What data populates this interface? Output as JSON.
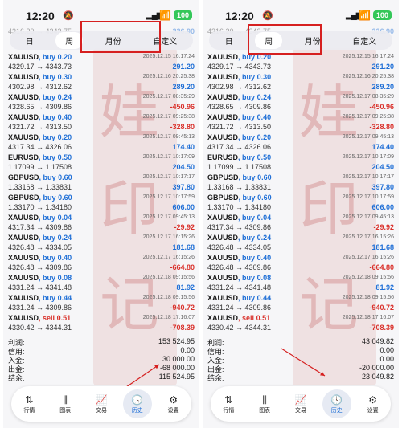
{
  "status": {
    "time": "12:20",
    "battery": "100"
  },
  "segments": [
    "日",
    "周",
    "月份",
    "自定义"
  ],
  "panels": [
    {
      "active_segment": "周",
      "partial_top": {
        "label": "4316.20 → 4343.75",
        "profit": "336.90"
      },
      "trades": [
        {
          "symbol": "XAUUSD",
          "side": "buy",
          "lot": "0.20",
          "prices": "4329.17 → 4343.73",
          "time": "2025.12.15 16:17:24",
          "profit": "291.20",
          "sign": "pos"
        },
        {
          "symbol": "XAUUSD",
          "side": "buy",
          "lot": "0.30",
          "prices": "4302.98 → 4312.62",
          "time": "2025.12.16 20:25:38",
          "profit": "289.20",
          "sign": "pos"
        },
        {
          "symbol": "XAUUSD",
          "side": "buy",
          "lot": "0.24",
          "prices": "4328.65 → 4309.86",
          "time": "2025.12.17 08:35:29",
          "profit": "-450.96",
          "sign": "neg"
        },
        {
          "symbol": "XAUUSD",
          "side": "buy",
          "lot": "0.40",
          "prices": "4321.72 → 4313.50",
          "time": "2025.12.17 09:25:38",
          "profit": "-328.80",
          "sign": "neg"
        },
        {
          "symbol": "XAUUSD",
          "side": "buy",
          "lot": "0.20",
          "prices": "4317.34 → 4326.06",
          "time": "2025.12.17 09:45:13",
          "profit": "174.40",
          "sign": "pos"
        },
        {
          "symbol": "EURUSD",
          "side": "buy",
          "lot": "0.50",
          "prices": "1.17099 → 1.17508",
          "time": "2025.12.17 10:17:09",
          "profit": "204.50",
          "sign": "pos"
        },
        {
          "symbol": "GBPUSD",
          "side": "buy",
          "lot": "0.60",
          "prices": "1.33168 → 1.33831",
          "time": "2025.12.17 10:17:17",
          "profit": "397.80",
          "sign": "pos"
        },
        {
          "symbol": "GBPUSD",
          "side": "buy",
          "lot": "0.60",
          "prices": "1.33170 → 1.34180",
          "time": "2025.12.17 10:17:59",
          "profit": "606.00",
          "sign": "pos"
        },
        {
          "symbol": "XAUUSD",
          "side": "buy",
          "lot": "0.04",
          "prices": "4317.34 → 4309.86",
          "time": "2025.12.17 09:45:13",
          "profit": "-29.92",
          "sign": "neg"
        },
        {
          "symbol": "XAUUSD",
          "side": "buy",
          "lot": "0.24",
          "prices": "4326.48 → 4334.05",
          "time": "2025.12.17 16:15:26",
          "profit": "181.68",
          "sign": "pos"
        },
        {
          "symbol": "XAUUSD",
          "side": "buy",
          "lot": "0.40",
          "prices": "4326.48 → 4309.86",
          "time": "2025.12.17 16:15:26",
          "profit": "-664.80",
          "sign": "neg"
        },
        {
          "symbol": "XAUUSD",
          "side": "buy",
          "lot": "0.08",
          "prices": "4331.24 → 4341.48",
          "time": "2025.12.18 09:15:56",
          "profit": "81.92",
          "sign": "pos"
        },
        {
          "symbol": "XAUUSD",
          "side": "buy",
          "lot": "0.44",
          "prices": "4331.24 → 4309.86",
          "time": "2025.12.18 09:15:56",
          "profit": "-940.72",
          "sign": "neg"
        },
        {
          "symbol": "XAUUSD",
          "side": "sell",
          "lot": "0.51",
          "prices": "4330.42 → 4344.31",
          "time": "2025.12.18 17:16:07",
          "profit": "-708.39",
          "sign": "neg"
        }
      ],
      "summary": [
        {
          "label": "利润:",
          "value": "153 524.95"
        },
        {
          "label": "信用:",
          "value": "0.00"
        },
        {
          "label": "入金:",
          "value": "30 000.00"
        },
        {
          "label": "出金:",
          "value": "-68 000.00"
        },
        {
          "label": "结余:",
          "value": "115 524.95"
        }
      ]
    },
    {
      "active_segment": "周",
      "partial_top": {
        "label": "4316.20 → 4343.75",
        "profit": "336.90"
      },
      "trades": [
        {
          "symbol": "XAUUSD",
          "side": "buy",
          "lot": "0.20",
          "prices": "4329.17 → 4343.73",
          "time": "2025.12.15 16:17:24",
          "profit": "291.20",
          "sign": "pos"
        },
        {
          "symbol": "XAUUSD",
          "side": "buy",
          "lot": "0.30",
          "prices": "4302.98 → 4312.62",
          "time": "2025.12.16 20:25:38",
          "profit": "289.20",
          "sign": "pos"
        },
        {
          "symbol": "XAUUSD",
          "side": "buy",
          "lot": "0.24",
          "prices": "4328.65 → 4309.86",
          "time": "2025.12.17 08:35:29",
          "profit": "-450.96",
          "sign": "neg"
        },
        {
          "symbol": "XAUUSD",
          "side": "buy",
          "lot": "0.40",
          "prices": "4321.72 → 4313.50",
          "time": "2025.12.17 09:25:38",
          "profit": "-328.80",
          "sign": "neg"
        },
        {
          "symbol": "XAUUSD",
          "side": "buy",
          "lot": "0.20",
          "prices": "4317.34 → 4326.06",
          "time": "2025.12.17 09:45:13",
          "profit": "174.40",
          "sign": "pos"
        },
        {
          "symbol": "EURUSD",
          "side": "buy",
          "lot": "0.50",
          "prices": "1.17099 → 1.17508",
          "time": "2025.12.17 10:17:09",
          "profit": "204.50",
          "sign": "pos"
        },
        {
          "symbol": "GBPUSD",
          "side": "buy",
          "lot": "0.60",
          "prices": "1.33168 → 1.33831",
          "time": "2025.12.17 10:17:17",
          "profit": "397.80",
          "sign": "pos"
        },
        {
          "symbol": "GBPUSD",
          "side": "buy",
          "lot": "0.60",
          "prices": "1.33170 → 1.34180",
          "time": "2025.12.17 10:17:59",
          "profit": "606.00",
          "sign": "pos"
        },
        {
          "symbol": "XAUUSD",
          "side": "buy",
          "lot": "0.04",
          "prices": "4317.34 → 4309.86",
          "time": "2025.12.17 09:45:13",
          "profit": "-29.92",
          "sign": "neg"
        },
        {
          "symbol": "XAUUSD",
          "side": "buy",
          "lot": "0.24",
          "prices": "4326.48 → 4334.05",
          "time": "2025.12.17 16:15:26",
          "profit": "181.68",
          "sign": "pos"
        },
        {
          "symbol": "XAUUSD",
          "side": "buy",
          "lot": "0.40",
          "prices": "4326.48 → 4309.86",
          "time": "2025.12.17 16:15:26",
          "profit": "-664.80",
          "sign": "neg"
        },
        {
          "symbol": "XAUUSD",
          "side": "buy",
          "lot": "0.08",
          "prices": "4331.24 → 4341.48",
          "time": "2025.12.18 09:15:56",
          "profit": "81.92",
          "sign": "pos"
        },
        {
          "symbol": "XAUUSD",
          "side": "buy",
          "lot": "0.44",
          "prices": "4331.24 → 4309.86",
          "time": "2025.12.18 09:15:56",
          "profit": "-940.72",
          "sign": "neg"
        },
        {
          "symbol": "XAUUSD",
          "side": "sell",
          "lot": "0.51",
          "prices": "4330.42 → 4344.31",
          "time": "2025.12.18 17:16:07",
          "profit": "-708.39",
          "sign": "neg"
        }
      ],
      "summary": [
        {
          "label": "利润:",
          "value": "43 049.82"
        },
        {
          "label": "信用:",
          "value": "0.00"
        },
        {
          "label": "入金:",
          "value": "0.00"
        },
        {
          "label": "出金:",
          "value": "-20 000.00"
        },
        {
          "label": "结余:",
          "value": "23 049.82"
        }
      ]
    }
  ],
  "tabs": [
    {
      "label": "行情",
      "icon": "quotes-icon",
      "glyph": "⇅"
    },
    {
      "label": "图表",
      "icon": "candlestick-chart-icon",
      "glyph": "⫼"
    },
    {
      "label": "交易",
      "icon": "trade-chart-icon",
      "glyph": "📈"
    },
    {
      "label": "历史",
      "icon": "history-clock-icon",
      "glyph": "🕓"
    },
    {
      "label": "设置",
      "icon": "settings-gear-icon",
      "glyph": "⚙"
    }
  ],
  "watermark_chars": [
    "娃",
    "印",
    "记"
  ],
  "colors": {
    "buy": "#1f6fd6",
    "sell": "#d9302a",
    "profit_pos": "#1f6fd6",
    "profit_neg": "#d9302a",
    "annotation_red": "#d62020",
    "battery": "#34c759"
  }
}
